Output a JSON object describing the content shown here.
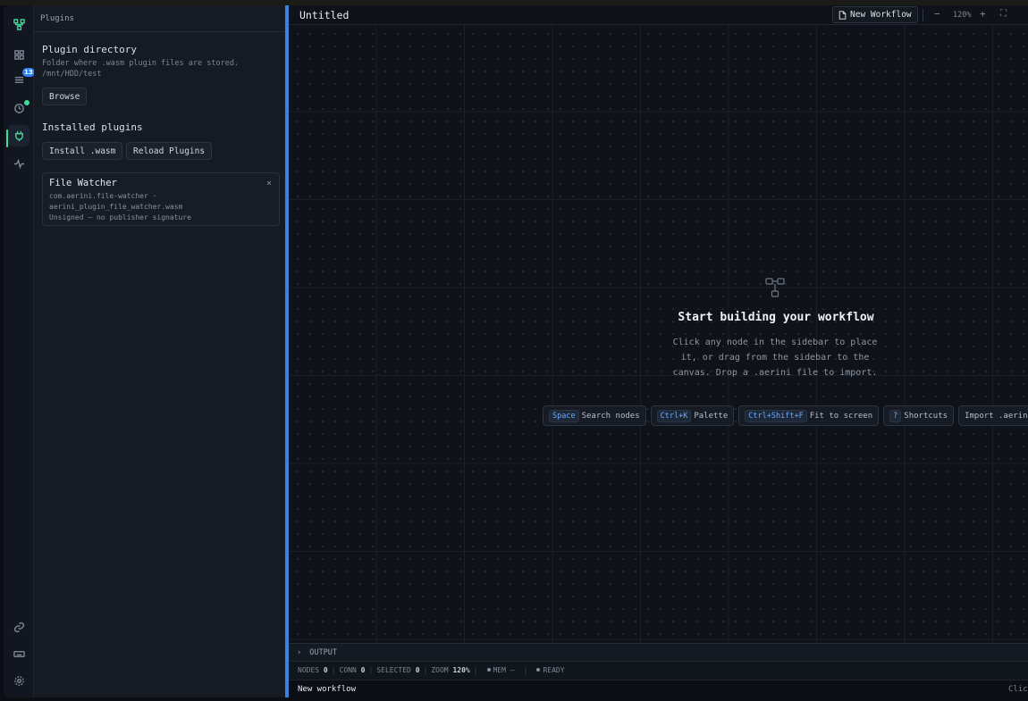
{
  "panel": {
    "header": "Plugins",
    "directory": {
      "title": "Plugin directory",
      "help": "Folder where .wasm plugin files are stored.",
      "path": "/mnt/HDD/test",
      "browse_label": "Browse"
    },
    "installed": {
      "title": "Installed plugins",
      "install_label": "Install .wasm",
      "reload_label": "Reload Plugins",
      "plugins": [
        {
          "name": "File Watcher",
          "id": "com.aerini.file-watcher ·",
          "file": "aerini_plugin_file_watcher.wasm",
          "signature": "Unsigned — no publisher signature",
          "close": "×"
        }
      ]
    }
  },
  "rail": {
    "badge_count": "13",
    "accent": "#3ddc97"
  },
  "main": {
    "title": "Untitled",
    "new_workflow_label": "New Workflow",
    "zoom_out": "−",
    "zoom_level": "120%",
    "zoom_in": "+",
    "fullscreen": "⛶"
  },
  "empty_state": {
    "title": "Start building your workflow",
    "description": "Click any node in the sidebar to place it, or drag from the sidebar to the canvas. Drop a .aerini file to import.",
    "hints": [
      {
        "key": "Space",
        "label": "Search nodes"
      },
      {
        "key": "Ctrl+K",
        "label": "Palette"
      },
      {
        "key": "Ctrl+Shift+F",
        "label": "Fit to screen"
      },
      {
        "key": "?",
        "label": "Shortcuts"
      },
      {
        "key": "",
        "label": "Import .aerini"
      }
    ]
  },
  "output": {
    "label": "OUTPUT",
    "chevron": "›"
  },
  "status": {
    "nodes_label": "NODES",
    "nodes": "0",
    "conn_label": "CONN",
    "conn": "0",
    "selected_label": "SELECTED",
    "selected": "0",
    "zoom_label": "ZOOM",
    "zoom": "120%",
    "mem_label": "MEM",
    "mem": "—",
    "ready": "READY"
  },
  "footer": {
    "text": "New workflow",
    "right": "Click"
  },
  "colors": {
    "accent_blue": "#3b82e0",
    "badge_blue": "#2f81f7"
  }
}
